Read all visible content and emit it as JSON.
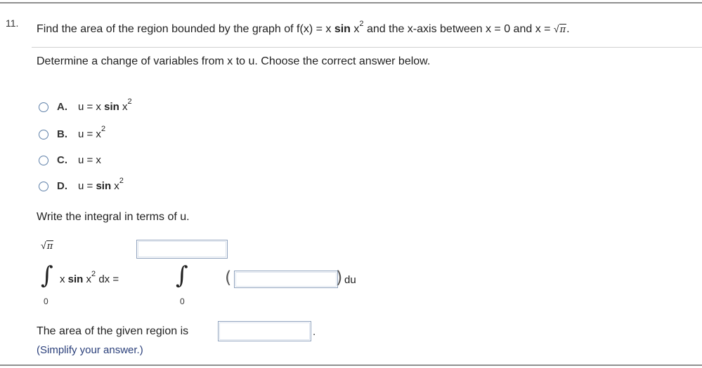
{
  "question": {
    "number": "11.",
    "stem": {
      "pre": "Find the area of the region bounded by the graph of f(x) = x ",
      "sin": "sin",
      "x": " x",
      "exp": "2",
      "mid": " and the x-axis between x = 0 and x = ",
      "sqrt_pi": "π",
      "end": "."
    },
    "part1_prompt": "Determine a change of variables from x to u. Choose the correct answer below.",
    "options": [
      {
        "letter": "A.",
        "pre": "u = x ",
        "bold": "sin",
        "post": " x",
        "exp": "2"
      },
      {
        "letter": "B.",
        "pre": "u = x",
        "bold": "",
        "post": "",
        "exp": "2"
      },
      {
        "letter": "C.",
        "pre": "u = x",
        "bold": "",
        "post": "",
        "exp": ""
      },
      {
        "letter": "D.",
        "pre": "u = ",
        "bold": "sin",
        "post": " x",
        "exp": "2"
      }
    ],
    "part2_prompt": "Write the integral in terms of u.",
    "integral": {
      "upper": "π",
      "lower": "0",
      "integrand_pre": "x ",
      "integrand_sin": "sin",
      "integrand_x": " x",
      "integrand_exp": "2",
      "integrand_dx": " dx =",
      "rhs_lower": "0",
      "du": "du"
    },
    "part3_prompt": "The area of the given region is",
    "part3_end": ".",
    "simplify_note": "(Simplify your answer.)"
  }
}
